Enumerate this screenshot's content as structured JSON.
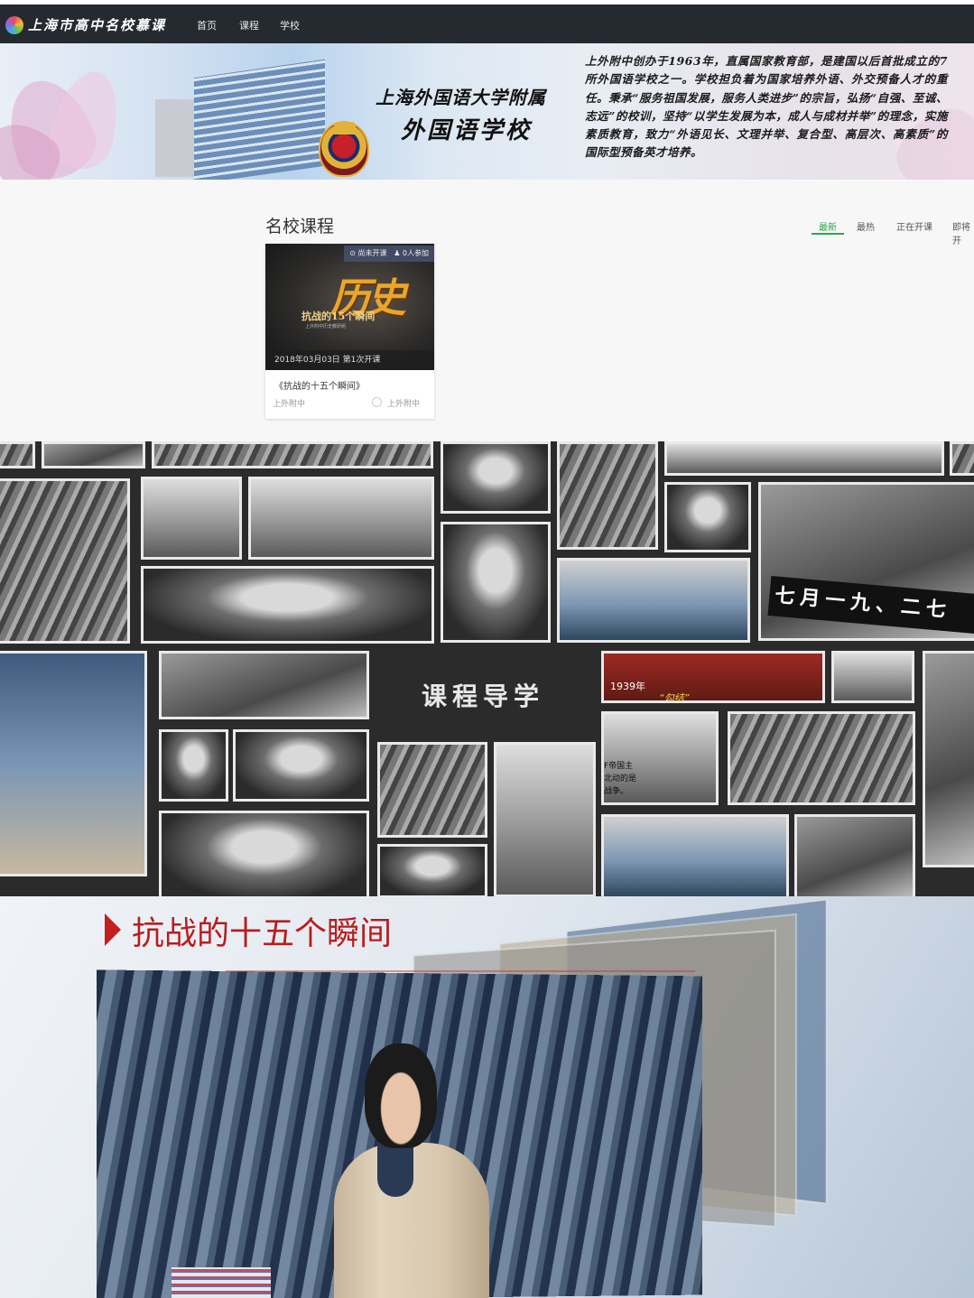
{
  "nav": {
    "brand": "上海市高中名校慕课",
    "items": [
      "首页",
      "课程",
      "学校"
    ]
  },
  "banner": {
    "school_name_line1": "上海外国语大学附属",
    "school_name_line2": "外国语学校",
    "description": "上外附中创办于1963年，直属国家教育部，是建国以后首批成立的7所外国语学校之一。学校担负着为国家培养外语、外交预备人才的重任。秉承“服务祖国发展，服务人类进步”的宗旨，弘扬“自强、至诚、志远”的校训，坚持“以学生发展为本，成人与成材并举”的理念，实施素质教育，致力“外语见长、文理并举、复合型、高层次、高素质”的国际型预备英才培养。"
  },
  "courses": {
    "section_title": "名校课程",
    "tabs": [
      "最新",
      "最热",
      "正在开课",
      "即将开"
    ],
    "active_tab": "最新",
    "card": {
      "status": "尚未开课",
      "participants": "0人参加",
      "thumb_title": "历史",
      "thumb_subtitle": "抗战的15个瞬间",
      "thumb_caption": "上外附中历史教研组",
      "date_line": "2018年03月03日 第1次开课",
      "title": "《抗战的十五个瞬间》",
      "school": "上外附中",
      "teacher": "上外附中"
    }
  },
  "collage": {
    "guide_text": "课程导学",
    "caption_year": "1939年",
    "caption_highlight": "“勾结”",
    "caption_side": "F帝国主\n北动的是\n战争。",
    "slogan": "七月一九、二七"
  },
  "video": {
    "title": "抗战的十五个瞬间"
  },
  "colors": {
    "nav_bg": "#252a30",
    "accent_green": "#2ea44f",
    "title_red": "#b61e1e"
  }
}
